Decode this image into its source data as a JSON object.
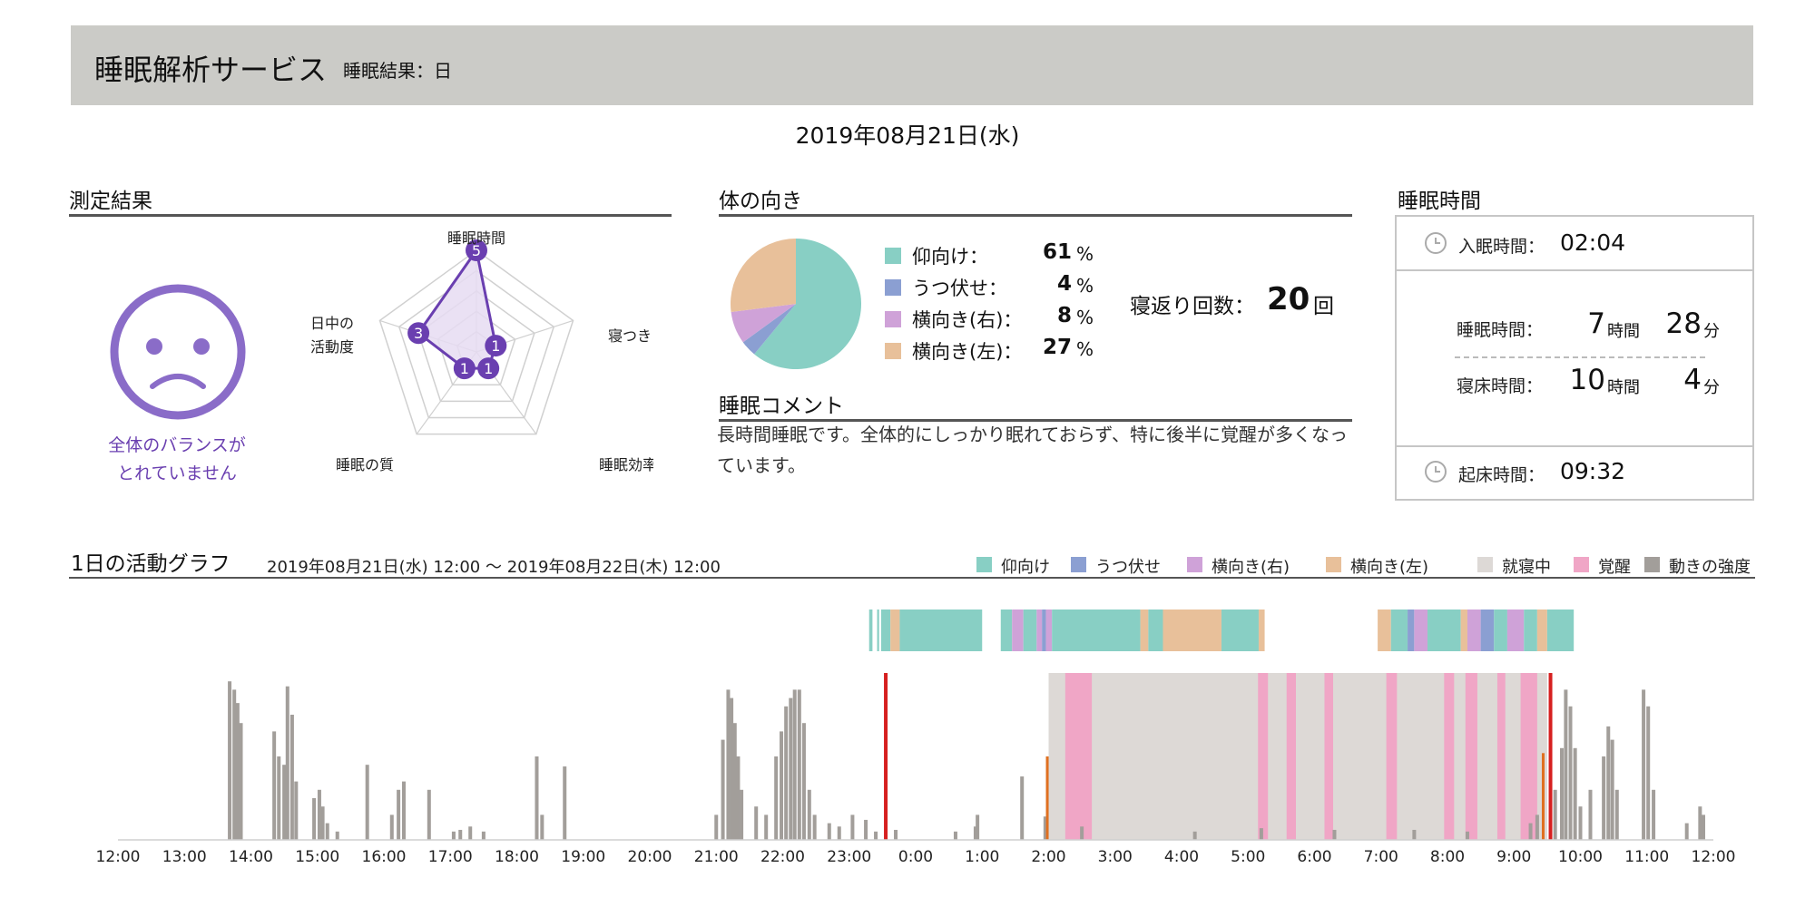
{
  "header": {
    "title": "睡眠解析サービス",
    "subtitle": "睡眠結果：日"
  },
  "date": "2019年08月21日(水)",
  "measure": {
    "title": "測定結果",
    "face_icon": "sad-face-icon",
    "balance_line1": "全体のバランスが",
    "balance_line2": "とれていません",
    "radar": {
      "axes": [
        {
          "lines": [
            "睡眠時間"
          ],
          "score": "5"
        },
        {
          "lines": [
            "寝つき"
          ],
          "score": "1"
        },
        {
          "lines": [
            "睡眠効率"
          ],
          "score": "1"
        },
        {
          "lines": [
            "睡眠の質"
          ],
          "score": "1"
        },
        {
          "lines": [
            "日中の",
            "活動度"
          ],
          "score": "3"
        }
      ],
      "max": 5,
      "color": "#6a3fb0"
    }
  },
  "body_direction": {
    "title": "体の向き",
    "pie": [
      {
        "label": "仰向け：",
        "value": "61",
        "color": "#88cfc4"
      },
      {
        "label": "うつ伏せ：",
        "value": "4",
        "color": "#8b9fd2"
      },
      {
        "label": "横向き(右)：",
        "value": "8",
        "color": "#cfa2d8"
      },
      {
        "label": "横向き(左)：",
        "value": "27",
        "color": "#e8c09a"
      }
    ],
    "pct_unit": "%",
    "turn_label": "寝返り回数：",
    "turn_count": "20",
    "turn_unit": "回"
  },
  "comment": {
    "title": "睡眠コメント",
    "text": "長時間睡眠です。全体的にしっかり眠れておらず、特に後半に覚醒が多くなっています。"
  },
  "sleep_time": {
    "title": "睡眠時間",
    "sleep_onset_label": "入眠時間：",
    "sleep_onset": "02:04",
    "duration_label": "睡眠時間：",
    "duration_h": "7",
    "duration_m": "28",
    "bed_label": "寝床時間：",
    "bed_h": "10",
    "bed_m": "4",
    "hour_unit": "時間",
    "min_unit": "分",
    "wake_label": "起床時間：",
    "wake": "09:32",
    "clock_icon": "clock-icon"
  },
  "activity": {
    "title": "1日の活動グラフ",
    "range": "2019年08月21日(水) 12:00 〜 2019年08月22日(木) 12:00",
    "legend": [
      {
        "label": "仰向け",
        "color": "#88cfc4"
      },
      {
        "label": "うつ伏せ",
        "color": "#8b9fd2"
      },
      {
        "label": "横向き(右)",
        "color": "#cfa2d8"
      },
      {
        "label": "横向き(左)",
        "color": "#e8c09a"
      },
      {
        "label": "就寝中",
        "color": "#ddd9d6"
      },
      {
        "label": "覚醒",
        "color": "#f0a6c6"
      },
      {
        "label": "動きの強度",
        "color": "#a29e9a"
      }
    ],
    "ticks": [
      "12:00",
      "13:00",
      "14:00",
      "15:00",
      "16:00",
      "17:00",
      "18:00",
      "19:00",
      "20:00",
      "21:00",
      "22:00",
      "23:00",
      "0:00",
      "1:00",
      "2:00",
      "3:00",
      "4:00",
      "5:00",
      "6:00",
      "7:00",
      "8:00",
      "9:00",
      "10:00",
      "11:00",
      "12:00"
    ],
    "posture_segments": [
      [
        11.3,
        11.35,
        "#88cfc4"
      ],
      [
        11.42,
        11.45,
        "#88cfc4"
      ],
      [
        11.48,
        11.62,
        "#88cfc4"
      ],
      [
        11.62,
        11.76,
        "#e8c09a"
      ],
      [
        11.76,
        13.0,
        "#88cfc4"
      ],
      [
        13.28,
        13.45,
        "#88cfc4"
      ],
      [
        13.45,
        13.62,
        "#cfa2d8"
      ],
      [
        13.62,
        13.82,
        "#88cfc4"
      ],
      [
        13.82,
        13.9,
        "#cfa2d8"
      ],
      [
        13.9,
        13.96,
        "#8b9fd2"
      ],
      [
        13.96,
        14.05,
        "#cfa2d8"
      ],
      [
        14.05,
        15.38,
        "#88cfc4"
      ],
      [
        15.38,
        15.5,
        "#e8c09a"
      ],
      [
        15.5,
        15.72,
        "#88cfc4"
      ],
      [
        15.72,
        16.6,
        "#e8c09a"
      ],
      [
        16.6,
        17.16,
        "#88cfc4"
      ],
      [
        17.16,
        17.25,
        "#e8c09a"
      ],
      [
        18.95,
        19.15,
        "#e8c09a"
      ],
      [
        19.15,
        19.4,
        "#88cfc4"
      ],
      [
        19.4,
        19.5,
        "#8b9fd2"
      ],
      [
        19.5,
        19.7,
        "#cfa2d8"
      ],
      [
        19.7,
        20.2,
        "#88cfc4"
      ],
      [
        20.2,
        20.3,
        "#e8c09a"
      ],
      [
        20.3,
        20.5,
        "#cfa2d8"
      ],
      [
        20.5,
        20.7,
        "#8b9fd2"
      ],
      [
        20.7,
        20.9,
        "#88cfc4"
      ],
      [
        20.9,
        21.15,
        "#cfa2d8"
      ],
      [
        21.15,
        21.35,
        "#88cfc4"
      ],
      [
        21.35,
        21.5,
        "#e8c09a"
      ],
      [
        21.5,
        21.9,
        "#88cfc4"
      ]
    ],
    "in_bed": [
      14.0,
      21.5
    ],
    "awake_periods": [
      [
        14.25,
        14.65
      ],
      [
        17.15,
        17.3
      ],
      [
        17.58,
        17.72
      ],
      [
        18.15,
        18.28
      ],
      [
        19.08,
        19.24
      ],
      [
        19.95,
        20.1
      ],
      [
        20.27,
        20.45
      ],
      [
        20.75,
        20.87
      ],
      [
        21.1,
        21.35
      ]
    ],
    "red_markers": [
      11.55,
      21.55
    ],
    "orange_markers": [
      [
        13.98,
        0.5
      ],
      [
        21.44,
        0.52
      ]
    ],
    "activity_spikes": [
      [
        1.68,
        0.95
      ],
      [
        1.75,
        0.9
      ],
      [
        1.8,
        0.82
      ],
      [
        1.85,
        0.7
      ],
      [
        2.35,
        0.65
      ],
      [
        2.42,
        0.5
      ],
      [
        2.5,
        0.45
      ],
      [
        2.55,
        0.92
      ],
      [
        2.62,
        0.75
      ],
      [
        2.68,
        0.35
      ],
      [
        2.95,
        0.25
      ],
      [
        3.03,
        0.3
      ],
      [
        3.08,
        0.2
      ],
      [
        3.15,
        0.1
      ],
      [
        3.3,
        0.05
      ],
      [
        3.75,
        0.45
      ],
      [
        4.12,
        0.15
      ],
      [
        4.22,
        0.3
      ],
      [
        4.3,
        0.35
      ],
      [
        4.68,
        0.3
      ],
      [
        5.05,
        0.05
      ],
      [
        5.15,
        0.06
      ],
      [
        5.3,
        0.08
      ],
      [
        5.5,
        0.05
      ],
      [
        6.3,
        0.5
      ],
      [
        6.38,
        0.15
      ],
      [
        6.72,
        0.44
      ],
      [
        9.0,
        0.15
      ],
      [
        9.1,
        0.6
      ],
      [
        9.18,
        0.9
      ],
      [
        9.23,
        0.85
      ],
      [
        9.28,
        0.7
      ],
      [
        9.33,
        0.5
      ],
      [
        9.38,
        0.3
      ],
      [
        9.6,
        0.2
      ],
      [
        9.75,
        0.15
      ],
      [
        9.9,
        0.5
      ],
      [
        9.98,
        0.65
      ],
      [
        10.05,
        0.8
      ],
      [
        10.12,
        0.85
      ],
      [
        10.18,
        0.9
      ],
      [
        10.25,
        0.9
      ],
      [
        10.32,
        0.7
      ],
      [
        10.4,
        0.3
      ],
      [
        10.48,
        0.15
      ],
      [
        10.7,
        0.1
      ],
      [
        10.85,
        0.08
      ],
      [
        11.05,
        0.15
      ],
      [
        11.25,
        0.12
      ],
      [
        11.4,
        0.05
      ],
      [
        11.7,
        0.06
      ],
      [
        12.6,
        0.05
      ],
      [
        12.9,
        0.08
      ],
      [
        12.93,
        0.15
      ],
      [
        13.6,
        0.38
      ],
      [
        13.95,
        0.14
      ],
      [
        14.5,
        0.08
      ],
      [
        16.2,
        0.05
      ],
      [
        17.2,
        0.07
      ],
      [
        18.3,
        0.06
      ],
      [
        19.5,
        0.06
      ],
      [
        20.3,
        0.05
      ],
      [
        21.25,
        0.1
      ],
      [
        21.35,
        0.15
      ],
      [
        21.62,
        0.3
      ],
      [
        21.72,
        0.55
      ],
      [
        21.78,
        0.9
      ],
      [
        21.85,
        0.8
      ],
      [
        21.92,
        0.55
      ],
      [
        22.0,
        0.2
      ],
      [
        22.15,
        0.3
      ],
      [
        22.35,
        0.5
      ],
      [
        22.42,
        0.68
      ],
      [
        22.48,
        0.6
      ],
      [
        22.55,
        0.3
      ],
      [
        22.95,
        0.9
      ],
      [
        23.02,
        0.8
      ],
      [
        23.1,
        0.3
      ],
      [
        23.6,
        0.1
      ],
      [
        23.8,
        0.2
      ],
      [
        23.85,
        0.15
      ]
    ]
  }
}
